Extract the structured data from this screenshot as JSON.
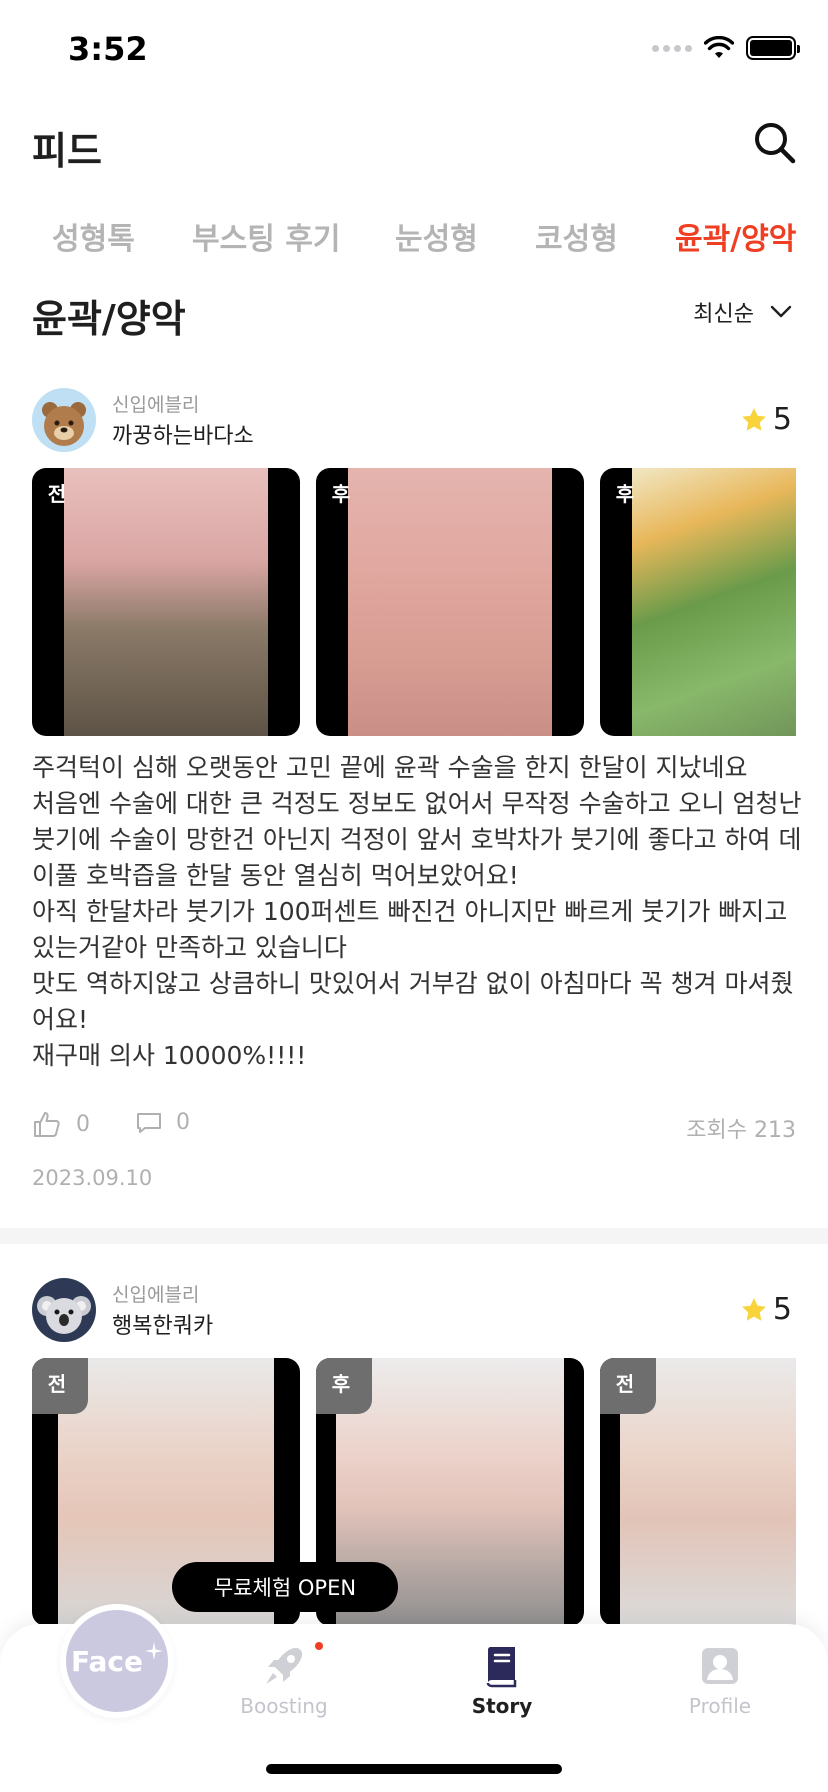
{
  "status_bar": {
    "time": "3:52"
  },
  "header": {
    "title": "피드",
    "search_icon": "search-icon"
  },
  "tabs": [
    {
      "label": "성형톡",
      "active": false
    },
    {
      "label": "부스팅 후기",
      "active": false
    },
    {
      "label": "눈성형",
      "active": false
    },
    {
      "label": "코성형",
      "active": false
    },
    {
      "label": "윤곽/양악",
      "active": true
    }
  ],
  "section": {
    "title": "윤곽/양악",
    "sort_label": "최신순"
  },
  "posts": [
    {
      "grade": "신입에블리",
      "username": "까꿍하는바다소",
      "avatar_icon": "bear-avatar-icon",
      "rating": "5",
      "photos": [
        {
          "tag": "전"
        },
        {
          "tag": "후"
        },
        {
          "tag": "후"
        }
      ],
      "body": "주걱턱이 심해 오랫동안 고민 끝에 윤곽 수술을 한지 한달이 지났네요\n처음엔 수술에 대한 큰 걱정도 정보도 없어서 무작정 수술하고 오니 엄청난 붓기에 수술이 망한건 아닌지 걱정이 앞서 호박차가 붓기에 좋다고 하여 데이풀 호박즙을 한달 동안 열심히 먹어보았어요!\n아직 한달차라 붓기가 100퍼센트 빠진건 아니지만 빠르게 붓기가 빠지고 있는거같아 만족하고 있습니다\n맛도 역하지않고 상큼하니 맛있어서 거부감 없이 아침마다 꼭 챙겨 마셔줬어요!\n재구매 의사 10000%!!!!",
      "likes": "0",
      "comments": "0",
      "views": "조회수 213",
      "date": "2023.09.10"
    },
    {
      "grade": "신입에블리",
      "username": "행복한쿼카",
      "avatar_icon": "koala-avatar-icon",
      "rating": "5",
      "photos": [
        {
          "tag": "전"
        },
        {
          "tag": "후"
        },
        {
          "tag": "전"
        }
      ]
    }
  ],
  "floating_button": {
    "label": "무료체험 OPEN"
  },
  "tabbar": {
    "face_label": "Face",
    "items": [
      {
        "label": "Boosting",
        "icon": "rocket-icon",
        "active": false,
        "has_dot": true
      },
      {
        "label": "Story",
        "icon": "book-icon",
        "active": true
      },
      {
        "label": "Profile",
        "icon": "profile-icon",
        "active": false
      }
    ]
  },
  "colors": {
    "accent": "#ef3e21",
    "inactive_tab": "#b4b4b4",
    "face_button": "#cbc9e0"
  }
}
